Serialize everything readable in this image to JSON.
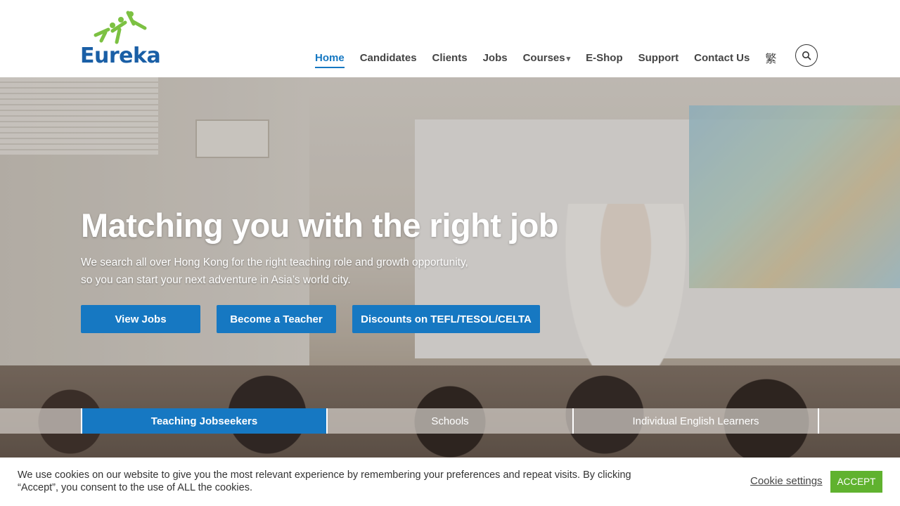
{
  "brand": {
    "name": "Eureka",
    "accent": "#1678c2",
    "logo_green": "#7cc142",
    "logo_blue": "#1a5fa6"
  },
  "nav": {
    "items": [
      {
        "label": "Home",
        "active": true
      },
      {
        "label": "Candidates"
      },
      {
        "label": "Clients"
      },
      {
        "label": "Jobs"
      },
      {
        "label": "Courses",
        "dropdown": true
      },
      {
        "label": "E-Shop"
      },
      {
        "label": "Support"
      },
      {
        "label": "Contact Us"
      }
    ],
    "language": "繁",
    "search_icon": "search-icon"
  },
  "hero": {
    "title": "Matching you with the right job",
    "subtitle_line1": "We search all over Hong Kong for the right teaching role and growth opportunity,",
    "subtitle_line2": "so you can start your next adventure in Asia’s world city.",
    "buttons": [
      "View Jobs",
      "Become a Teacher",
      "Discounts on TEFL/TESOL/CELTA"
    ],
    "tabs": [
      "Teaching Jobseekers",
      "Schools",
      "Individual English Learners"
    ]
  },
  "cookie": {
    "text": "We use cookies on our website to give you the most relevant experience by remembering your preferences and repeat visits. By clicking “Accept”, you consent to the use of ALL the cookies.",
    "settings_label": "Cookie settings",
    "accept_label": "ACCEPT",
    "accept_color": "#60b22f"
  }
}
